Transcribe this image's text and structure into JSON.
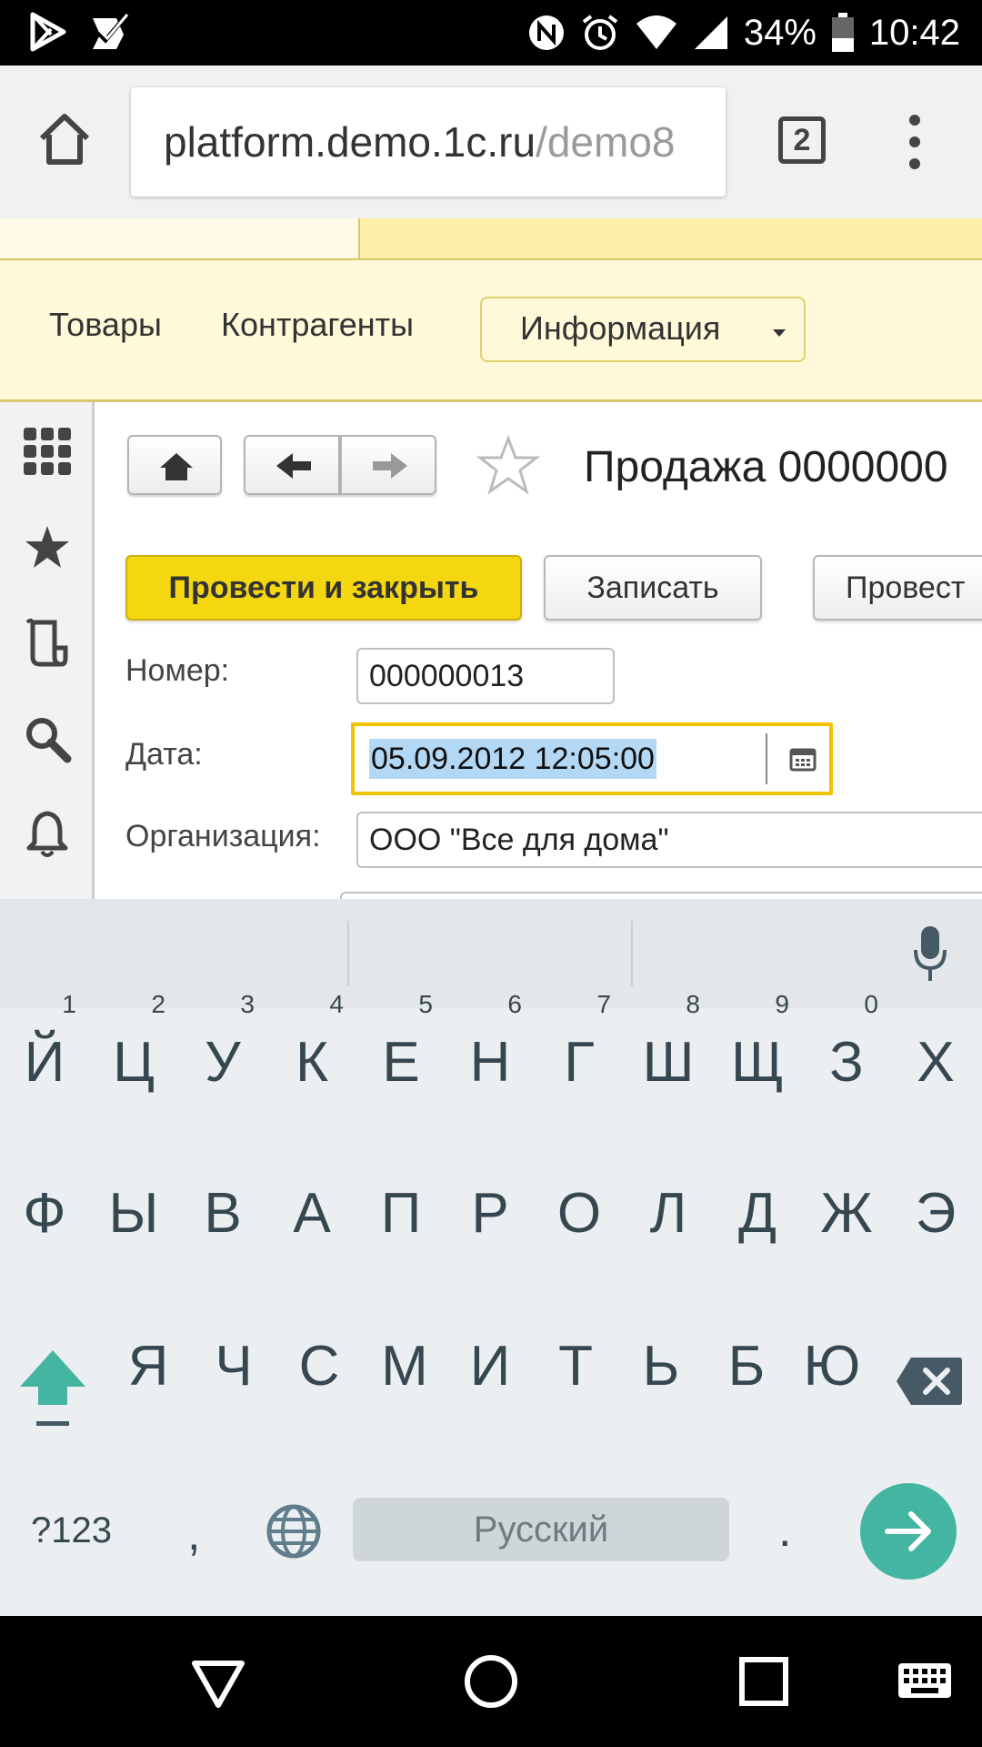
{
  "status_bar": {
    "battery": "34%",
    "time": "10:42",
    "icons": [
      "play-store-icon",
      "task-check-icon",
      "nfc-icon",
      "alarm-icon",
      "wifi-icon",
      "signal-icon",
      "battery-icon"
    ]
  },
  "browser": {
    "url_host": "platform.demo.1c.ru",
    "url_path": "/demo8",
    "tab_count": "2"
  },
  "app_nav": {
    "items": [
      "Товары",
      "Контрагенты"
    ],
    "info_dropdown": "Информация"
  },
  "document": {
    "title": "Продажа 0000000",
    "buttons": {
      "post_close": "Провести и закрыть",
      "save": "Записать",
      "post": "Провест"
    },
    "fields": {
      "number_label": "Номер:",
      "number_value": "000000013",
      "date_label": "Дата:",
      "date_value": "05.09.2012 12:05:00",
      "org_label": "Организация:",
      "org_value": "ООО \"Все для дома\""
    }
  },
  "keyboard": {
    "row1": [
      "Й",
      "Ц",
      "У",
      "К",
      "Е",
      "Н",
      "Г",
      "Ш",
      "Щ",
      "З",
      "Х"
    ],
    "row1_hints": [
      "1",
      "2",
      "3",
      "4",
      "5",
      "6",
      "7",
      "8",
      "9",
      "0",
      ""
    ],
    "row2": [
      "Ф",
      "Ы",
      "В",
      "А",
      "П",
      "Р",
      "О",
      "Л",
      "Д",
      "Ж",
      "Э"
    ],
    "row3": [
      "Я",
      "Ч",
      "С",
      "М",
      "И",
      "Т",
      "Ь",
      "Б",
      "Ю"
    ],
    "symbols_key": "?123",
    "comma": ",",
    "period": ".",
    "space_label": "Русский"
  },
  "colors": {
    "primary_button": "#f4d611",
    "focus_border": "#f2c200",
    "selection": "#b3d8f5",
    "enter_key": "#43b5a0"
  }
}
